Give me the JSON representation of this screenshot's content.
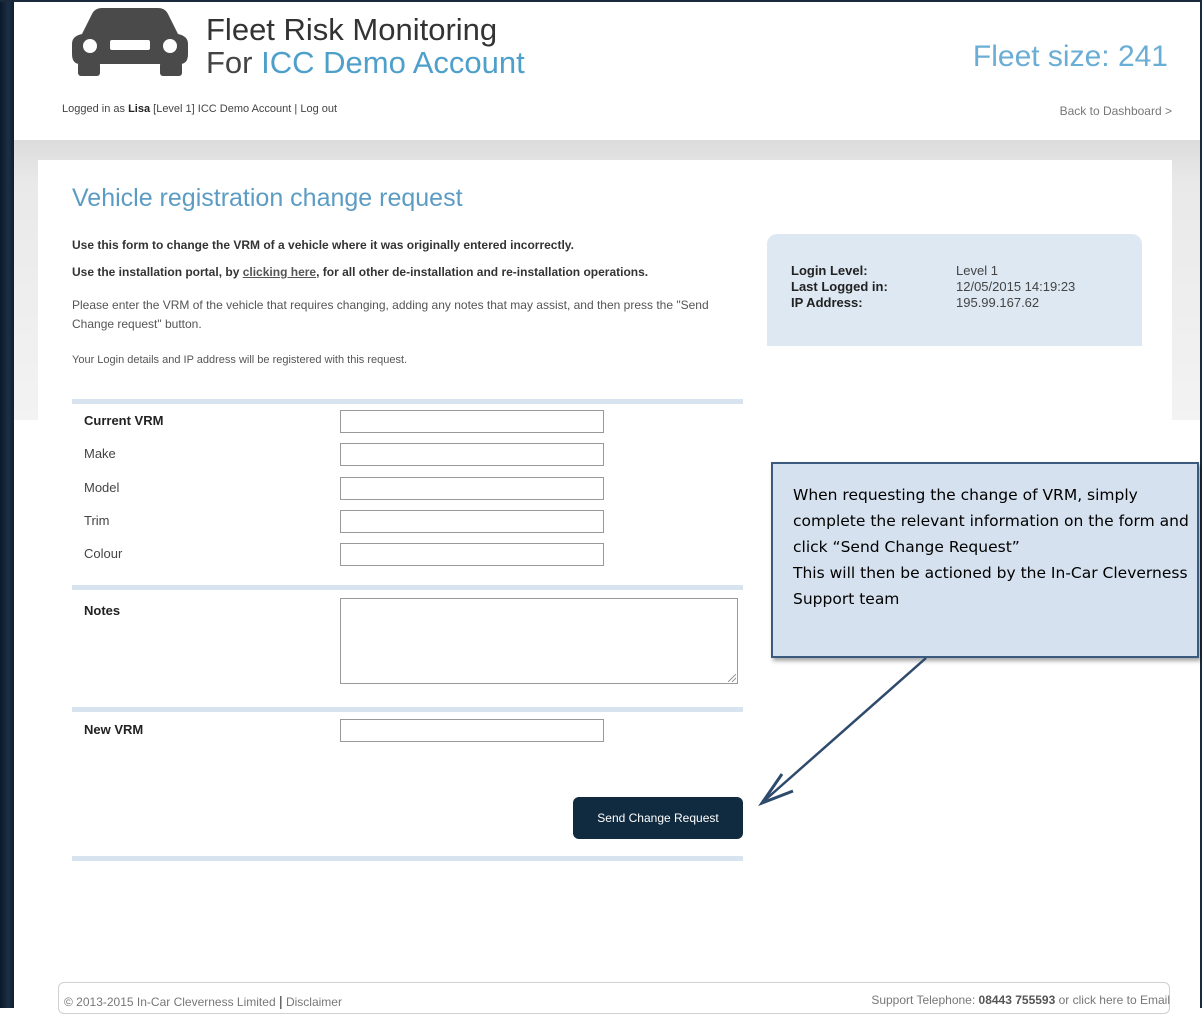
{
  "header": {
    "title": "Fleet Risk Monitoring",
    "subtitle_prefix": "For",
    "account_name": "ICC Demo Account",
    "fleet_size": "Fleet size: 241",
    "logged_prefix": "Logged in as",
    "user": "Lisa",
    "level": "[Level 1]",
    "account": "ICC Demo Account",
    "separator": "|",
    "logout": "Log out",
    "back_link": "Back to Dashboard >"
  },
  "page": {
    "title": "Vehicle registration change request",
    "intro1": "Use this form to change the VRM of a vehicle where it was originally entered incorrectly.",
    "intro2_pre": "Use the installation portal, by",
    "intro2_link": "clicking here",
    "intro2_post": ", for all other de-installation and re-installation operations.",
    "intro3": "Please enter the VRM of the vehicle that requires changing, adding any notes that may assist, and then press the \"Send Change request\" button.",
    "intro4": "Your Login details and IP address will be registered with this request."
  },
  "login_info": {
    "login_level_label": "Login Level:",
    "login_level_value": "Level 1",
    "last_logged_label": "Last Logged in:",
    "last_logged_value": "12/05/2015 14:19:23",
    "ip_label": "IP Address:",
    "ip_value": "195.99.167.62"
  },
  "form": {
    "current_vrm_label": "Current VRM",
    "make_label": "Make",
    "model_label": "Model",
    "trim_label": "Trim",
    "colour_label": "Colour",
    "notes_label": "Notes",
    "new_vrm_label": "New VRM",
    "current_vrm_value": "",
    "make_value": "",
    "model_value": "",
    "trim_value": "",
    "colour_value": "",
    "new_vrm_value": "",
    "submit_label": "Send Change Request"
  },
  "callout": {
    "text": "When requesting the change of VRM, simply complete the relevant information on the form and click “Send Change Request”\nThis will then be actioned by the In-Car Cleverness Support team"
  },
  "footer": {
    "copyright": "© 2013-2015 In-Car Cleverness Limited",
    "divider": "|",
    "disclaimer": "Disclaimer",
    "support_label": "Support Telephone:",
    "support_phone": "08443 755593",
    "email_text": "or click here to Email"
  },
  "colors": {
    "accent": "#5c9cc4",
    "button": "#102a3f",
    "info_box": "#dde8f2",
    "callout_fill": "#d5e1ee",
    "callout_border": "#3c5a7e"
  }
}
